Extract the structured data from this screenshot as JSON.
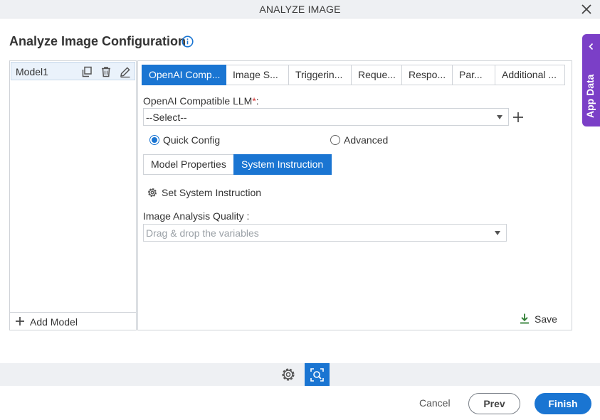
{
  "window": {
    "title": "ANALYZE IMAGE",
    "close_icon": "close-icon"
  },
  "page": {
    "title": "Analyze Image Configuration",
    "info_icon": "info-icon"
  },
  "models": {
    "items": [
      {
        "label": "Model1"
      }
    ],
    "row_icons": [
      "copy-icon",
      "delete-icon",
      "edit-icon"
    ],
    "add_label": "Add Model"
  },
  "tabs": [
    {
      "label": "OpenAI Comp...",
      "active": true
    },
    {
      "label": "Image S...",
      "active": false
    },
    {
      "label": "Triggerin...",
      "active": false
    },
    {
      "label": "Reque...",
      "active": false
    },
    {
      "label": "Respo...",
      "active": false
    },
    {
      "label": "Par...",
      "active": false
    },
    {
      "label": "Additional ...",
      "active": false
    }
  ],
  "llm": {
    "label": "OpenAI Compatible LLM",
    "required_mark": "*",
    "colon": ":",
    "value": "--Select--"
  },
  "config_mode": {
    "quick": {
      "label": "Quick Config",
      "selected": true
    },
    "advanced": {
      "label": "Advanced",
      "selected": false
    }
  },
  "subtabs": [
    {
      "label": "Model Properties",
      "active": false
    },
    {
      "label": "System Instruction",
      "active": true
    }
  ],
  "set_instruction": {
    "label": "Set System Instruction"
  },
  "quality": {
    "label": "Image Analysis Quality :",
    "placeholder": "Drag & drop the variables"
  },
  "save": {
    "label": "Save"
  },
  "app_data": {
    "label": "App Data"
  },
  "footer": {
    "cancel": "Cancel",
    "prev": "Prev",
    "finish": "Finish"
  },
  "colors": {
    "accent": "#1a75d2",
    "app_data": "#7b3fc7",
    "required": "#d32f2f",
    "save_icon": "#2e7d32"
  }
}
